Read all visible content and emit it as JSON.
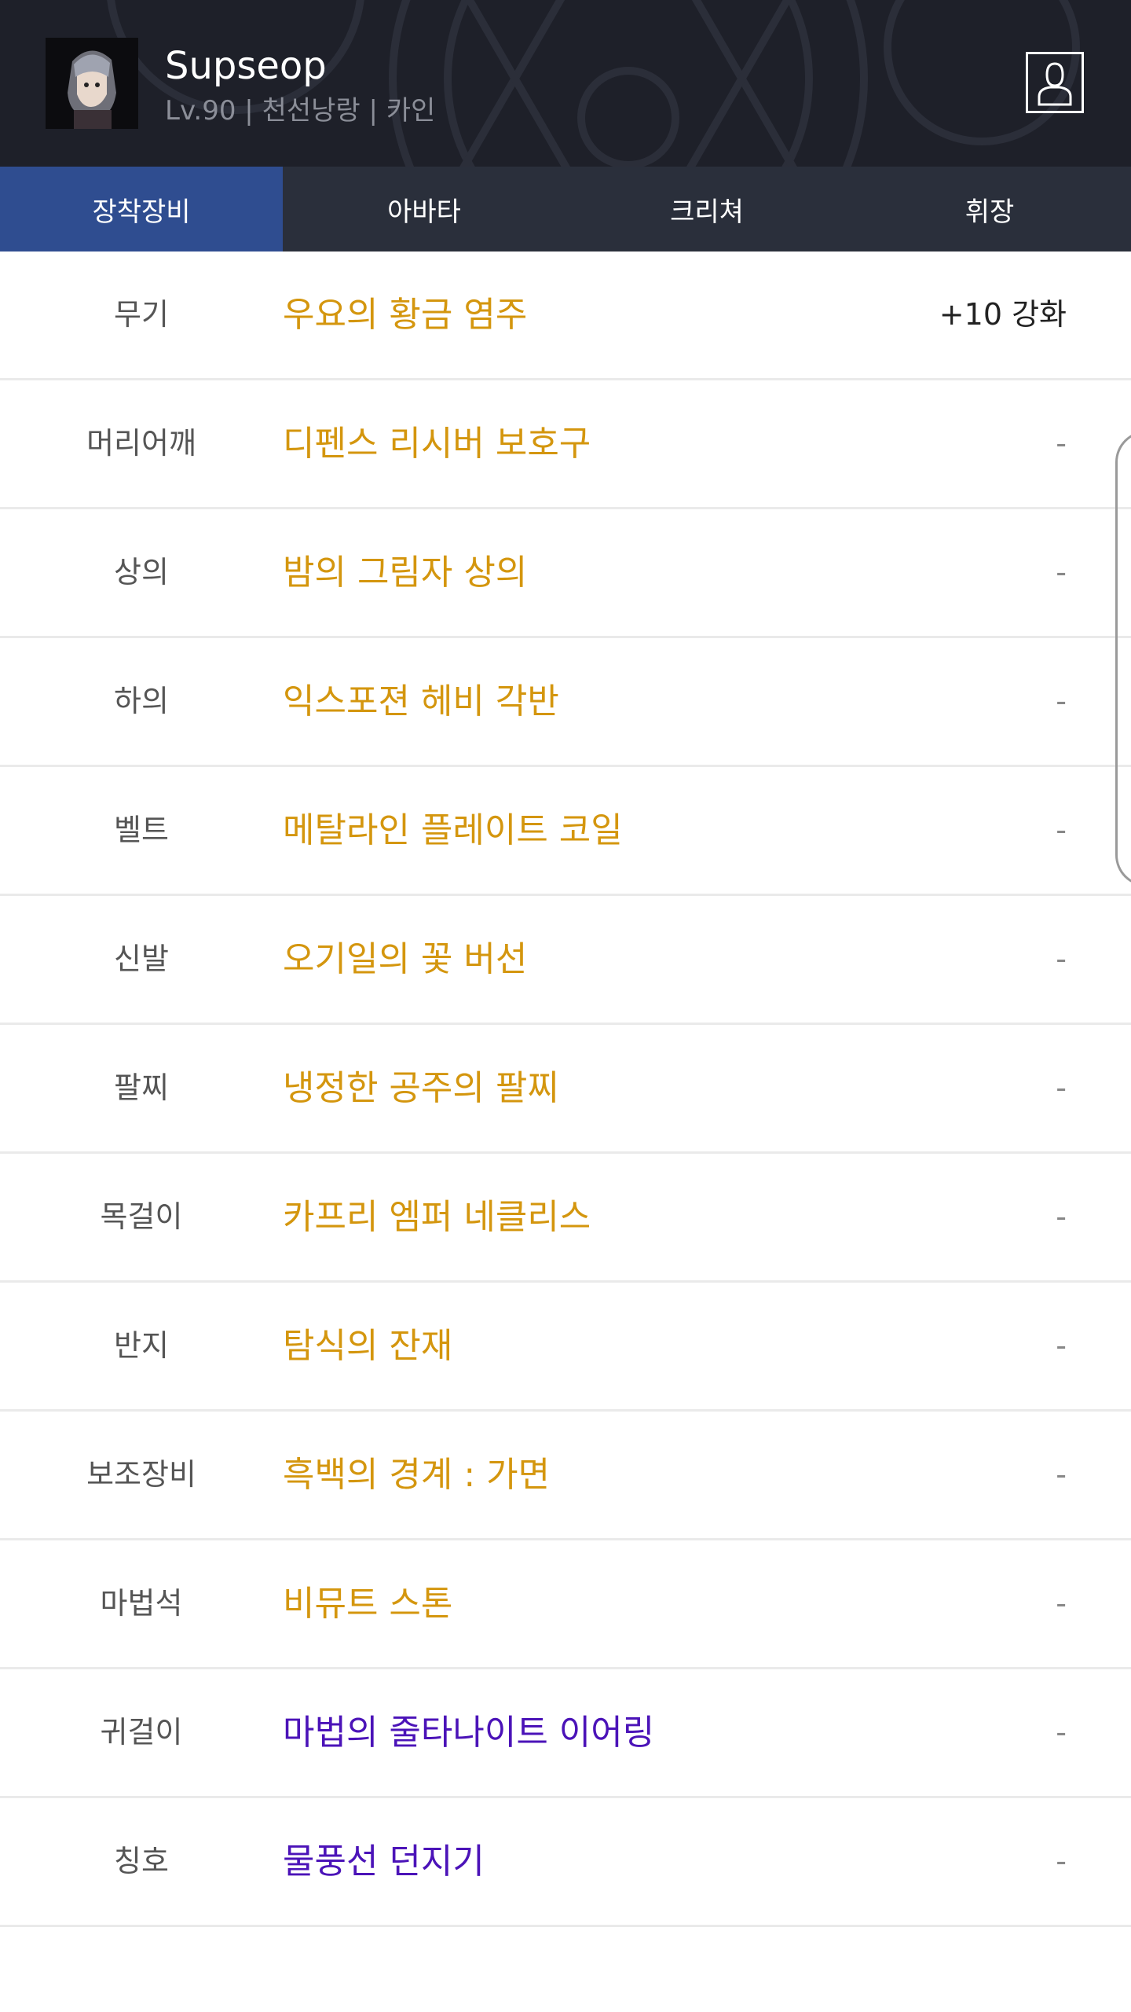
{
  "character": {
    "name": "Supseop",
    "info": "Lv.90 | 천선낭랑 | 카인"
  },
  "tabs": [
    {
      "label": "장착장비",
      "active": true
    },
    {
      "label": "아바타",
      "active": false
    },
    {
      "label": "크리쳐",
      "active": false
    },
    {
      "label": "휘장",
      "active": false
    }
  ],
  "equipment": [
    {
      "slot": "무기",
      "name": "우요의 황금 염주",
      "enhance": "+10 강화",
      "rarity": "unique"
    },
    {
      "slot": "머리어깨",
      "name": "디펜스 리시버 보호구",
      "enhance": "-",
      "rarity": "unique"
    },
    {
      "slot": "상의",
      "name": "밤의 그림자 상의",
      "enhance": "-",
      "rarity": "unique"
    },
    {
      "slot": "하의",
      "name": "익스포젼 헤비 각반",
      "enhance": "-",
      "rarity": "unique"
    },
    {
      "slot": "벨트",
      "name": "메탈라인 플레이트 코일",
      "enhance": "-",
      "rarity": "unique"
    },
    {
      "slot": "신발",
      "name": "오기일의 꽃 버선",
      "enhance": "-",
      "rarity": "unique"
    },
    {
      "slot": "팔찌",
      "name": "냉정한 공주의 팔찌",
      "enhance": "-",
      "rarity": "unique"
    },
    {
      "slot": "목걸이",
      "name": "카프리 엠퍼 네클리스",
      "enhance": "-",
      "rarity": "unique"
    },
    {
      "slot": "반지",
      "name": "탐식의 잔재",
      "enhance": "-",
      "rarity": "unique"
    },
    {
      "slot": "보조장비",
      "name": "흑백의 경계 : 가면",
      "enhance": "-",
      "rarity": "unique"
    },
    {
      "slot": "마법석",
      "name": "비뮤트 스톤",
      "enhance": "-",
      "rarity": "unique"
    },
    {
      "slot": "귀걸이",
      "name": "마법의 줄타나이트 이어링",
      "enhance": "-",
      "rarity": "legendary"
    },
    {
      "slot": "칭호",
      "name": "물풍선 던지기",
      "enhance": "-",
      "rarity": "legendary"
    }
  ],
  "colors": {
    "header_bg": "#1e2029",
    "tab_bar_bg": "#2a2f3b",
    "tab_active_bg": "#2f4d90",
    "unique_item": "#d4960e",
    "legendary_item": "#4b13b8"
  },
  "icons": {
    "profile": "person-icon",
    "avatar": "character-portrait"
  }
}
